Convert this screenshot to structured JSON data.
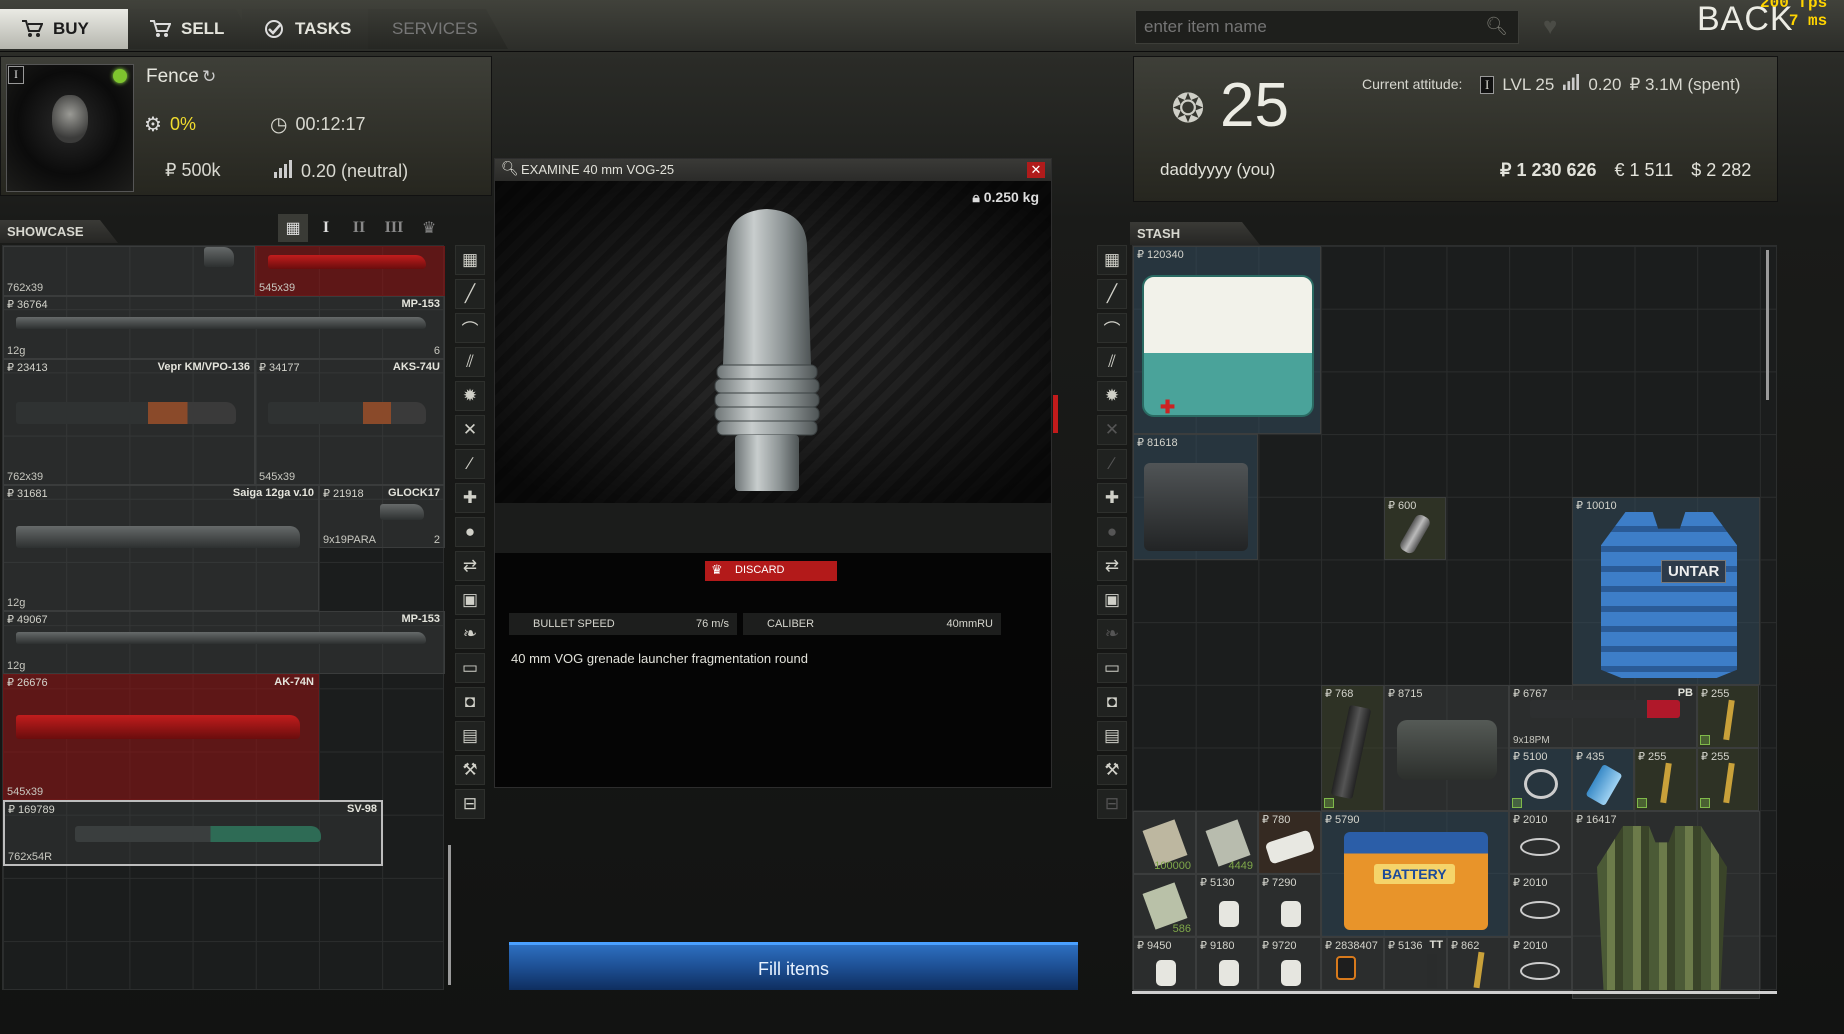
{
  "hud": {
    "fps": "200 fps",
    "latency": "7 ms",
    "back_label": "BACK"
  },
  "tabs": [
    {
      "label": "BUY",
      "icon": "cart-icon"
    },
    {
      "label": "SELL",
      "icon": "cart-icon"
    },
    {
      "label": "TASKS",
      "icon": "check-icon"
    },
    {
      "label": "SERVICES",
      "icon": ""
    }
  ],
  "search": {
    "placeholder": "enter item name",
    "value": ""
  },
  "trader": {
    "rank": "I",
    "name": "Fence",
    "discount": "0%",
    "restock_timer": "00:12:17",
    "budget": "₽ 500k",
    "standing": "0.20 (neutral)"
  },
  "showcase": {
    "label": "SHOWCASE",
    "items": [
      {
        "price": "",
        "name": "",
        "caliber": "762x39",
        "count": ""
      },
      {
        "price": "",
        "name": "",
        "caliber": "545x39",
        "count": ""
      },
      {
        "price": "₽ 36764",
        "name": "MP-153",
        "caliber": "12g",
        "count": "6"
      },
      {
        "price": "₽ 23413",
        "name": "Vepr KM/VPO-136",
        "caliber": "762x39",
        "count": ""
      },
      {
        "price": "₽ 34177",
        "name": "AKS-74U",
        "caliber": "545x39",
        "count": ""
      },
      {
        "price": "₽ 31681",
        "name": "Saiga 12ga v.10",
        "caliber": "12g",
        "count": ""
      },
      {
        "price": "₽ 21918",
        "name": "GLOCK17",
        "caliber": "9x19PARA",
        "count": "2"
      },
      {
        "price": "₽ 49067",
        "name": "MP-153",
        "caliber": "12g",
        "count": ""
      },
      {
        "price": "₽ 26676",
        "name": "AK-74N",
        "caliber": "545x39",
        "count": ""
      },
      {
        "price": "₽ 169789",
        "name": "SV-98",
        "caliber": "762x54R",
        "count": ""
      }
    ]
  },
  "examine": {
    "title": "EXAMINE 40 mm VOG-25",
    "weight": "0.250 kg",
    "discard_label": "DISCARD",
    "attributes": [
      {
        "label": "BULLET SPEED",
        "value": "76 m/s"
      },
      {
        "label": "CALIBER",
        "value": "40mmRU"
      }
    ],
    "description": "40 mm VOG grenade launcher fragmentation round"
  },
  "fill_button": "Fill items",
  "profile": {
    "level": "25",
    "username": "daddyyyy (you)",
    "attitude_label": "Current attitude:",
    "attitude_rank": "I",
    "lvl": "LVL 25",
    "standing": "0.20",
    "spent": "₽ 3.1M (spent)",
    "roubles": "₽ 1 230 626",
    "euros": "€ 1 511",
    "dollars": "$ 2 282"
  },
  "stash": {
    "label": "STASH",
    "items": [
      {
        "price": "₽ 120340",
        "tag": "",
        "caliber": "",
        "count": ""
      },
      {
        "price": "₽ 81618",
        "tag": "",
        "caliber": "",
        "count": ""
      },
      {
        "price": "₽ 600",
        "tag": "",
        "caliber": "",
        "count": ""
      },
      {
        "price": "₽ 10010",
        "tag": "",
        "caliber": "",
        "count": "",
        "label": "UNTAR"
      },
      {
        "price": "₽ 768",
        "tag": "",
        "caliber": "",
        "count": ""
      },
      {
        "price": "₽ 8715",
        "tag": "",
        "caliber": "",
        "count": ""
      },
      {
        "price": "₽ 6767",
        "tag": "PB",
        "caliber": "9x18PM",
        "count": ""
      },
      {
        "price": "₽ 255",
        "tag": "",
        "caliber": "",
        "count": ""
      },
      {
        "price": "₽ 5100",
        "tag": "",
        "caliber": "",
        "count": ""
      },
      {
        "price": "₽ 435",
        "tag": "",
        "caliber": "",
        "count": ""
      },
      {
        "price": "₽ 255",
        "tag": "",
        "caliber": "",
        "count": ""
      },
      {
        "price": "₽ 255",
        "tag": "",
        "caliber": "",
        "count": ""
      },
      {
        "price": "",
        "tag": "",
        "caliber": "",
        "count": "100000"
      },
      {
        "price": "",
        "tag": "",
        "caliber": "",
        "count": "4449"
      },
      {
        "price": "₽ 780",
        "tag": "",
        "caliber": "",
        "count": ""
      },
      {
        "price": "₽ 5790",
        "tag": "",
        "caliber": "",
        "count": "",
        "label": "BATTERY"
      },
      {
        "price": "₽ 2010",
        "tag": "",
        "caliber": "",
        "count": ""
      },
      {
        "price": "₽ 16417",
        "tag": "",
        "caliber": "",
        "count": ""
      },
      {
        "price": "",
        "tag": "",
        "caliber": "",
        "count": "586"
      },
      {
        "price": "₽ 5130",
        "tag": "",
        "caliber": "",
        "count": ""
      },
      {
        "price": "₽ 7290",
        "tag": "",
        "caliber": "",
        "count": ""
      },
      {
        "price": "₽ 2010",
        "tag": "",
        "caliber": "",
        "count": ""
      },
      {
        "price": "₽ 9450",
        "tag": "",
        "caliber": "",
        "count": ""
      },
      {
        "price": "₽ 9180",
        "tag": "",
        "caliber": "",
        "count": ""
      },
      {
        "price": "₽ 9720",
        "tag": "",
        "caliber": "",
        "count": ""
      },
      {
        "price": "₽ 2838407",
        "tag": "",
        "caliber": "",
        "count": ""
      },
      {
        "price": "₽ 5136",
        "tag": "TT",
        "caliber": "",
        "count": ""
      },
      {
        "price": "₽ 862",
        "tag": "",
        "caliber": "",
        "count": ""
      },
      {
        "price": "₽ 2010",
        "tag": "",
        "caliber": "",
        "count": ""
      }
    ]
  },
  "colors": {
    "accent_red": "#b31a1a",
    "fill_blue": "#1d4f93",
    "online_green": "#7ec42e",
    "discount_yellow": "#f0dc2e"
  }
}
